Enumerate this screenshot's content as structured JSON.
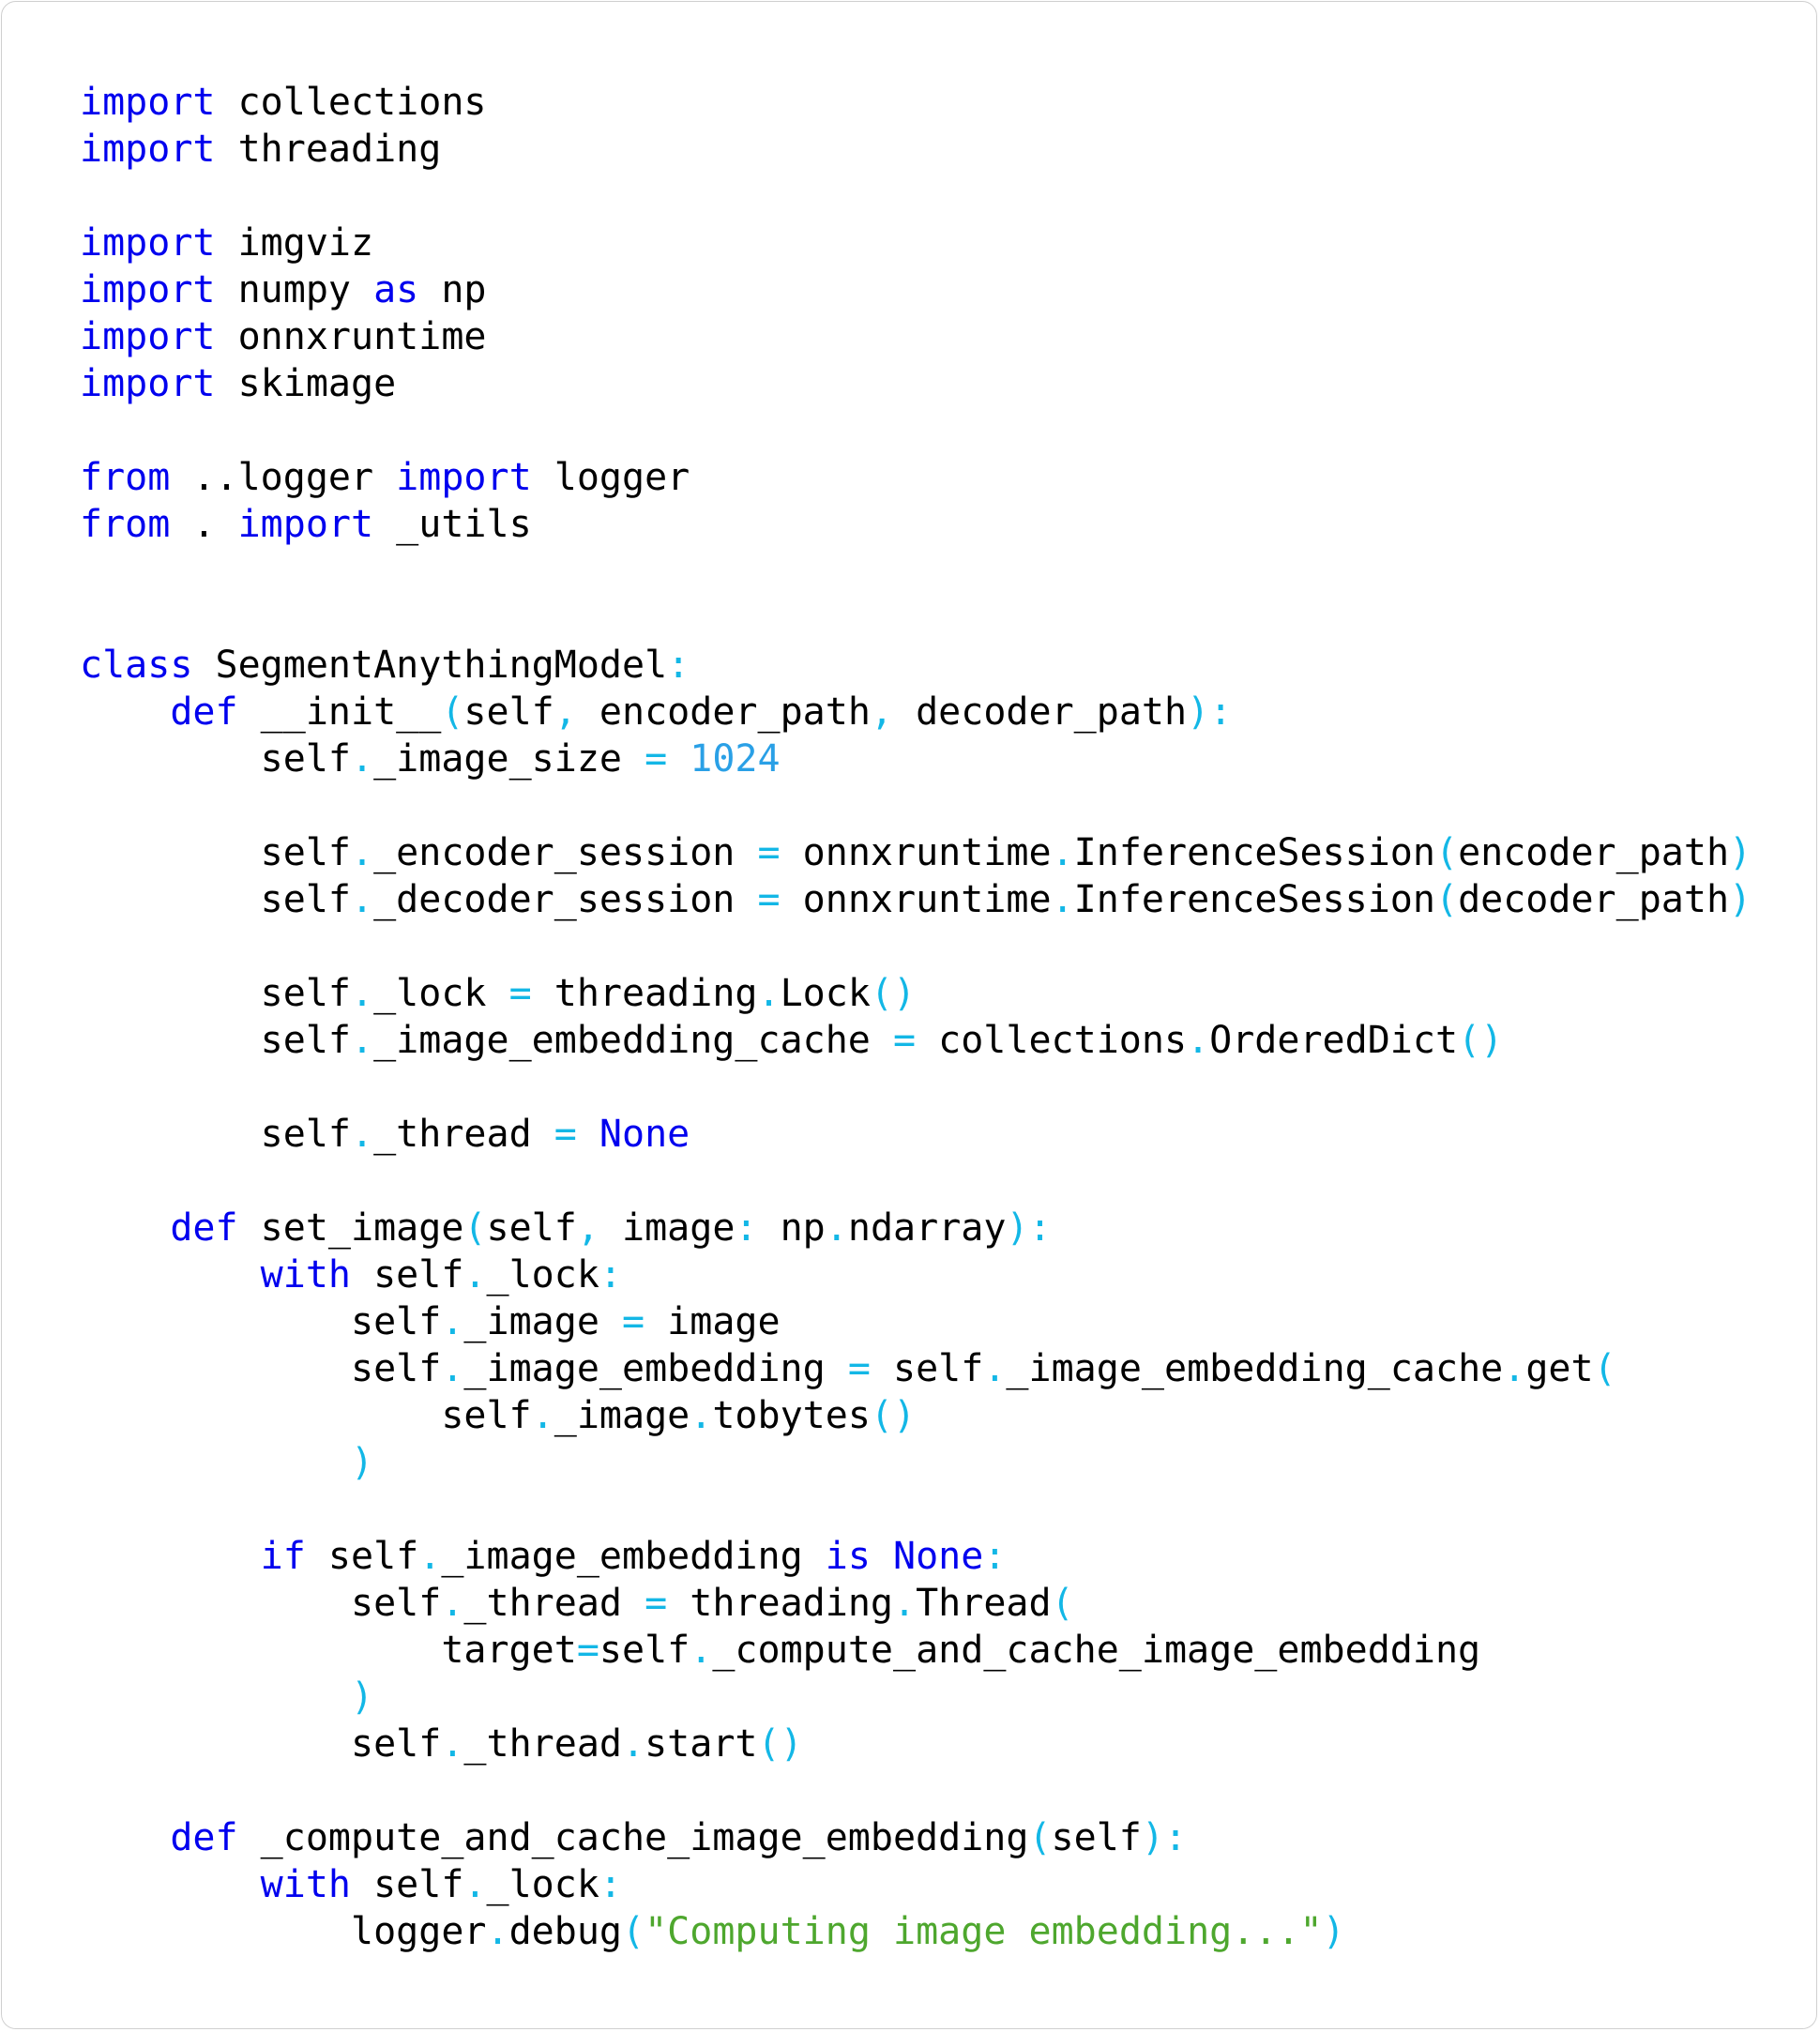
{
  "colors": {
    "keyword": "#0000ee",
    "operator": "#13b7e6",
    "number": "#2aa0e6",
    "string": "#4ea72e",
    "text": "#000000",
    "background": "#ffffff",
    "border": "#cfcfcf"
  },
  "code": {
    "lines": [
      [
        {
          "t": "kw",
          "v": "import"
        },
        {
          "t": "id",
          "v": " collections"
        }
      ],
      [
        {
          "t": "kw",
          "v": "import"
        },
        {
          "t": "id",
          "v": " threading"
        }
      ],
      [],
      [
        {
          "t": "kw",
          "v": "import"
        },
        {
          "t": "id",
          "v": " imgviz"
        }
      ],
      [
        {
          "t": "kw",
          "v": "import"
        },
        {
          "t": "id",
          "v": " numpy "
        },
        {
          "t": "kw",
          "v": "as"
        },
        {
          "t": "id",
          "v": " np"
        }
      ],
      [
        {
          "t": "kw",
          "v": "import"
        },
        {
          "t": "id",
          "v": " onnxruntime"
        }
      ],
      [
        {
          "t": "kw",
          "v": "import"
        },
        {
          "t": "id",
          "v": " skimage"
        }
      ],
      [],
      [
        {
          "t": "kw",
          "v": "from"
        },
        {
          "t": "id",
          "v": " ..logger "
        },
        {
          "t": "kw",
          "v": "import"
        },
        {
          "t": "id",
          "v": " logger"
        }
      ],
      [
        {
          "t": "kw",
          "v": "from"
        },
        {
          "t": "id",
          "v": " . "
        },
        {
          "t": "kw",
          "v": "import"
        },
        {
          "t": "id",
          "v": " _utils"
        }
      ],
      [],
      [],
      [
        {
          "t": "kw",
          "v": "class"
        },
        {
          "t": "id",
          "v": " SegmentAnythingModel"
        },
        {
          "t": "op",
          "v": ":"
        }
      ],
      [
        {
          "t": "id",
          "v": "    "
        },
        {
          "t": "kw",
          "v": "def"
        },
        {
          "t": "id",
          "v": " __init__"
        },
        {
          "t": "op",
          "v": "("
        },
        {
          "t": "id",
          "v": "self"
        },
        {
          "t": "op",
          "v": ","
        },
        {
          "t": "id",
          "v": " encoder_path"
        },
        {
          "t": "op",
          "v": ","
        },
        {
          "t": "id",
          "v": " decoder_path"
        },
        {
          "t": "op",
          "v": "):"
        }
      ],
      [
        {
          "t": "id",
          "v": "        self"
        },
        {
          "t": "op",
          "v": "."
        },
        {
          "t": "id",
          "v": "_image_size "
        },
        {
          "t": "op",
          "v": "="
        },
        {
          "t": "id",
          "v": " "
        },
        {
          "t": "num",
          "v": "1024"
        }
      ],
      [],
      [
        {
          "t": "id",
          "v": "        self"
        },
        {
          "t": "op",
          "v": "."
        },
        {
          "t": "id",
          "v": "_encoder_session "
        },
        {
          "t": "op",
          "v": "="
        },
        {
          "t": "id",
          "v": " onnxruntime"
        },
        {
          "t": "op",
          "v": "."
        },
        {
          "t": "id",
          "v": "InferenceSession"
        },
        {
          "t": "op",
          "v": "("
        },
        {
          "t": "id",
          "v": "encoder_path"
        },
        {
          "t": "op",
          "v": ")"
        }
      ],
      [
        {
          "t": "id",
          "v": "        self"
        },
        {
          "t": "op",
          "v": "."
        },
        {
          "t": "id",
          "v": "_decoder_session "
        },
        {
          "t": "op",
          "v": "="
        },
        {
          "t": "id",
          "v": " onnxruntime"
        },
        {
          "t": "op",
          "v": "."
        },
        {
          "t": "id",
          "v": "InferenceSession"
        },
        {
          "t": "op",
          "v": "("
        },
        {
          "t": "id",
          "v": "decoder_path"
        },
        {
          "t": "op",
          "v": ")"
        }
      ],
      [],
      [
        {
          "t": "id",
          "v": "        self"
        },
        {
          "t": "op",
          "v": "."
        },
        {
          "t": "id",
          "v": "_lock "
        },
        {
          "t": "op",
          "v": "="
        },
        {
          "t": "id",
          "v": " threading"
        },
        {
          "t": "op",
          "v": "."
        },
        {
          "t": "id",
          "v": "Lock"
        },
        {
          "t": "op",
          "v": "()"
        }
      ],
      [
        {
          "t": "id",
          "v": "        self"
        },
        {
          "t": "op",
          "v": "."
        },
        {
          "t": "id",
          "v": "_image_embedding_cache "
        },
        {
          "t": "op",
          "v": "="
        },
        {
          "t": "id",
          "v": " collections"
        },
        {
          "t": "op",
          "v": "."
        },
        {
          "t": "id",
          "v": "OrderedDict"
        },
        {
          "t": "op",
          "v": "()"
        }
      ],
      [],
      [
        {
          "t": "id",
          "v": "        self"
        },
        {
          "t": "op",
          "v": "."
        },
        {
          "t": "id",
          "v": "_thread "
        },
        {
          "t": "op",
          "v": "="
        },
        {
          "t": "id",
          "v": " "
        },
        {
          "t": "kw",
          "v": "None"
        }
      ],
      [],
      [
        {
          "t": "id",
          "v": "    "
        },
        {
          "t": "kw",
          "v": "def"
        },
        {
          "t": "id",
          "v": " set_image"
        },
        {
          "t": "op",
          "v": "("
        },
        {
          "t": "id",
          "v": "self"
        },
        {
          "t": "op",
          "v": ","
        },
        {
          "t": "id",
          "v": " image"
        },
        {
          "t": "op",
          "v": ":"
        },
        {
          "t": "id",
          "v": " np"
        },
        {
          "t": "op",
          "v": "."
        },
        {
          "t": "id",
          "v": "ndarray"
        },
        {
          "t": "op",
          "v": "):"
        }
      ],
      [
        {
          "t": "id",
          "v": "        "
        },
        {
          "t": "kw",
          "v": "with"
        },
        {
          "t": "id",
          "v": " self"
        },
        {
          "t": "op",
          "v": "."
        },
        {
          "t": "id",
          "v": "_lock"
        },
        {
          "t": "op",
          "v": ":"
        }
      ],
      [
        {
          "t": "id",
          "v": "            self"
        },
        {
          "t": "op",
          "v": "."
        },
        {
          "t": "id",
          "v": "_image "
        },
        {
          "t": "op",
          "v": "="
        },
        {
          "t": "id",
          "v": " image"
        }
      ],
      [
        {
          "t": "id",
          "v": "            self"
        },
        {
          "t": "op",
          "v": "."
        },
        {
          "t": "id",
          "v": "_image_embedding "
        },
        {
          "t": "op",
          "v": "="
        },
        {
          "t": "id",
          "v": " self"
        },
        {
          "t": "op",
          "v": "."
        },
        {
          "t": "id",
          "v": "_image_embedding_cache"
        },
        {
          "t": "op",
          "v": "."
        },
        {
          "t": "id",
          "v": "get"
        },
        {
          "t": "op",
          "v": "("
        }
      ],
      [
        {
          "t": "id",
          "v": "                self"
        },
        {
          "t": "op",
          "v": "."
        },
        {
          "t": "id",
          "v": "_image"
        },
        {
          "t": "op",
          "v": "."
        },
        {
          "t": "id",
          "v": "tobytes"
        },
        {
          "t": "op",
          "v": "()"
        }
      ],
      [
        {
          "t": "id",
          "v": "            "
        },
        {
          "t": "op",
          "v": ")"
        }
      ],
      [],
      [
        {
          "t": "id",
          "v": "        "
        },
        {
          "t": "kw",
          "v": "if"
        },
        {
          "t": "id",
          "v": " self"
        },
        {
          "t": "op",
          "v": "."
        },
        {
          "t": "id",
          "v": "_image_embedding "
        },
        {
          "t": "kw",
          "v": "is"
        },
        {
          "t": "id",
          "v": " "
        },
        {
          "t": "kw",
          "v": "None"
        },
        {
          "t": "op",
          "v": ":"
        }
      ],
      [
        {
          "t": "id",
          "v": "            self"
        },
        {
          "t": "op",
          "v": "."
        },
        {
          "t": "id",
          "v": "_thread "
        },
        {
          "t": "op",
          "v": "="
        },
        {
          "t": "id",
          "v": " threading"
        },
        {
          "t": "op",
          "v": "."
        },
        {
          "t": "id",
          "v": "Thread"
        },
        {
          "t": "op",
          "v": "("
        }
      ],
      [
        {
          "t": "id",
          "v": "                target"
        },
        {
          "t": "op",
          "v": "="
        },
        {
          "t": "id",
          "v": "self"
        },
        {
          "t": "op",
          "v": "."
        },
        {
          "t": "id",
          "v": "_compute_and_cache_image_embedding"
        }
      ],
      [
        {
          "t": "id",
          "v": "            "
        },
        {
          "t": "op",
          "v": ")"
        }
      ],
      [
        {
          "t": "id",
          "v": "            self"
        },
        {
          "t": "op",
          "v": "."
        },
        {
          "t": "id",
          "v": "_thread"
        },
        {
          "t": "op",
          "v": "."
        },
        {
          "t": "id",
          "v": "start"
        },
        {
          "t": "op",
          "v": "()"
        }
      ],
      [],
      [
        {
          "t": "id",
          "v": "    "
        },
        {
          "t": "kw",
          "v": "def"
        },
        {
          "t": "id",
          "v": " _compute_and_cache_image_embedding"
        },
        {
          "t": "op",
          "v": "("
        },
        {
          "t": "id",
          "v": "self"
        },
        {
          "t": "op",
          "v": "):"
        }
      ],
      [
        {
          "t": "id",
          "v": "        "
        },
        {
          "t": "kw",
          "v": "with"
        },
        {
          "t": "id",
          "v": " self"
        },
        {
          "t": "op",
          "v": "."
        },
        {
          "t": "id",
          "v": "_lock"
        },
        {
          "t": "op",
          "v": ":"
        }
      ],
      [
        {
          "t": "id",
          "v": "            logger"
        },
        {
          "t": "op",
          "v": "."
        },
        {
          "t": "id",
          "v": "debug"
        },
        {
          "t": "op",
          "v": "("
        },
        {
          "t": "str",
          "v": "\"Computing image embedding...\""
        },
        {
          "t": "op",
          "v": ")"
        }
      ]
    ]
  }
}
